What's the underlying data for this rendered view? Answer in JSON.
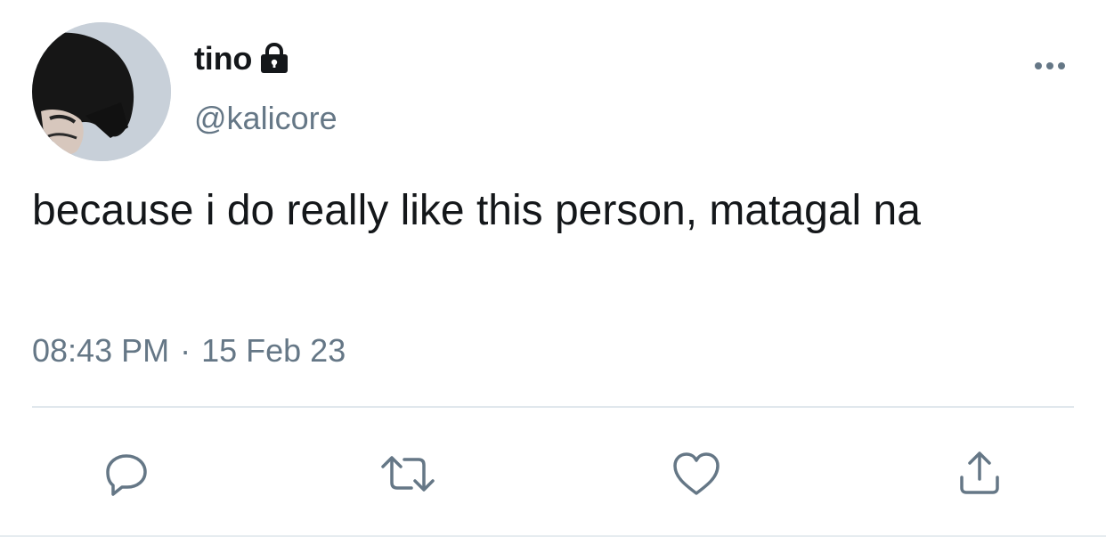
{
  "user": {
    "display_name": "tino",
    "handle": "@kalicore",
    "protected": true,
    "avatar_icon": "avatar-photo"
  },
  "tweet": {
    "text": "because i do really like this person, matagal na",
    "time": "08:43 PM",
    "separator": "·",
    "date": "15 Feb 23"
  },
  "actions": {
    "reply_icon": "reply-icon",
    "retweet_icon": "retweet-icon",
    "like_icon": "heart-icon",
    "share_icon": "share-icon"
  },
  "colors": {
    "text": "#14171a",
    "secondary": "#657786",
    "icon": "#657786",
    "divider": "#e1e8ed"
  }
}
